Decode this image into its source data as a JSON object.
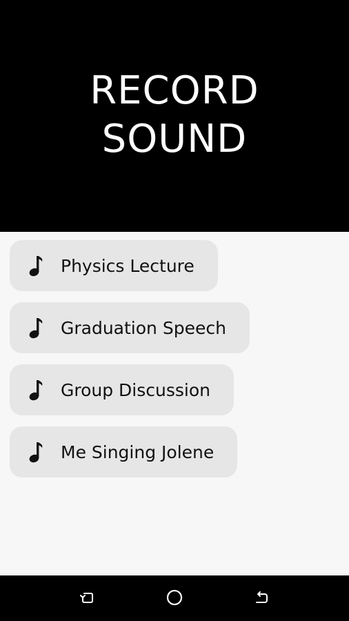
{
  "header": {
    "title_line1": "RECORD",
    "title_line2": "SOUND"
  },
  "recordings": [
    {
      "label": "Physics Lecture",
      "icon": "music-note-icon"
    },
    {
      "label": "Graduation Speech",
      "icon": "music-note-icon"
    },
    {
      "label": "Group Discussion",
      "icon": "music-note-icon"
    },
    {
      "label": "Me Singing Jolene",
      "icon": "music-note-icon"
    }
  ],
  "nav_bar": {
    "icons": [
      "recent-apps-icon",
      "home-icon",
      "back-icon"
    ]
  },
  "colors": {
    "header_bg": "#000000",
    "title_text": "#ffffff",
    "item_bg": "#e6e6e6",
    "page_bg": "#f7f7f7"
  }
}
